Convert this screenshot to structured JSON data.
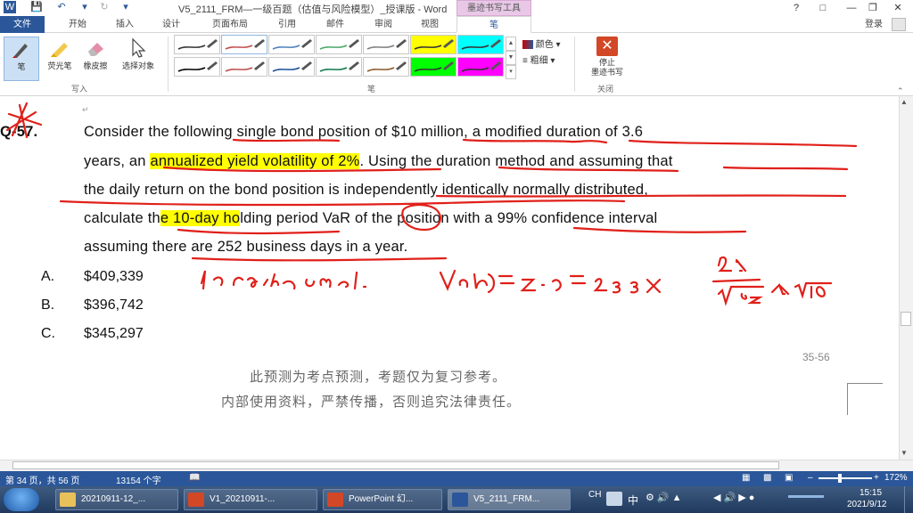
{
  "window": {
    "title": "V5_2111_FRM—一级百题（估值与风险模型）_授课版 - Word",
    "context_tab": "墨迹书写工具",
    "help": "?",
    "login": "登录"
  },
  "tabs": [
    "文件",
    "开始",
    "插入",
    "设计",
    "页面布局",
    "引用",
    "邮件",
    "审阅",
    "视图",
    "笔"
  ],
  "ribbon": {
    "write_group": {
      "pen": "笔",
      "highlighter": "荧光笔",
      "eraser": "橡皮擦",
      "select": "选择对象",
      "label": "写入"
    },
    "pens_label": "笔",
    "color_label": "颜色",
    "thickness_label": "粗细",
    "stop_ink_label": "停止\n墨迹书写",
    "close_label": "关闭"
  },
  "pen_swatches": [
    {
      "color": "#333333",
      "bg": "#ffffff"
    },
    {
      "color": "#c0504d",
      "bg": "#ffffff"
    },
    {
      "color": "#4f81bd",
      "bg": "#ffffff"
    },
    {
      "color": "#4aa86b",
      "bg": "#ffffff"
    },
    {
      "color": "#7f7f7f",
      "bg": "#ffffff"
    },
    {
      "color": "#ffff00",
      "bg": "#ffff00"
    },
    {
      "color": "#00ffff",
      "bg": "#00ffff"
    },
    {
      "color": "#000000",
      "bg": "#ffffff"
    },
    {
      "color": "#c0504d",
      "bg": "#ffffff"
    },
    {
      "color": "#1f4e99",
      "bg": "#ffffff"
    },
    {
      "color": "#0f7a4a",
      "bg": "#ffffff"
    },
    {
      "color": "#8b5a2b",
      "bg": "#ffffff"
    },
    {
      "color": "#00ff00",
      "bg": "#00ff00"
    },
    {
      "color": "#ff00ff",
      "bg": "#ff00ff"
    }
  ],
  "question": {
    "number": "Q-57.",
    "line1": "Consider the following single bond position of $10 million, a modified duration of 3.6",
    "line2_pre": "years, an ",
    "line2_hl": "annualized yield volatility of 2%",
    "line2_post": ". Using the duration method and assuming that",
    "line3": "the daily return on the bond position is independently identically normally distributed,",
    "line4_pre": "calculate th",
    "line4_hl": "e 10-day ho",
    "line4_post": "lding period VaR of the position with a 99% confidence interval",
    "line5": "assuming there are 252 business days in a year.",
    "options": [
      {
        "letter": "A.",
        "value": "$409,339"
      },
      {
        "letter": "B.",
        "value": "$396,742"
      },
      {
        "letter": "C.",
        "value": "$345,297"
      }
    ],
    "page_ref": "35-56"
  },
  "handwriting": "1. rate ~ normal.   VaR(dy) = Z·σ = 2.33 × 2% / √252 × √10",
  "footer_notes": [
    "此预测为考点预测，考题仅为复习参考。",
    "内部使用资料，严禁传播，否则追究法律责任。"
  ],
  "status": {
    "page": "第 34 页，共 56 页",
    "words": "13154 个字",
    "zoom": "172%"
  },
  "taskbar": {
    "items": [
      "20210911-12_...",
      "V1_20210911-...",
      "PowerPoint 幻...",
      "V5_2111_FRM..."
    ],
    "ime": "CH",
    "ime2": "中",
    "time": "15:15",
    "date": "2021/9/12"
  },
  "colors": {
    "word_blue": "#2b579a",
    "ink_red": "#e0201a",
    "highlight": "#ffff00"
  }
}
